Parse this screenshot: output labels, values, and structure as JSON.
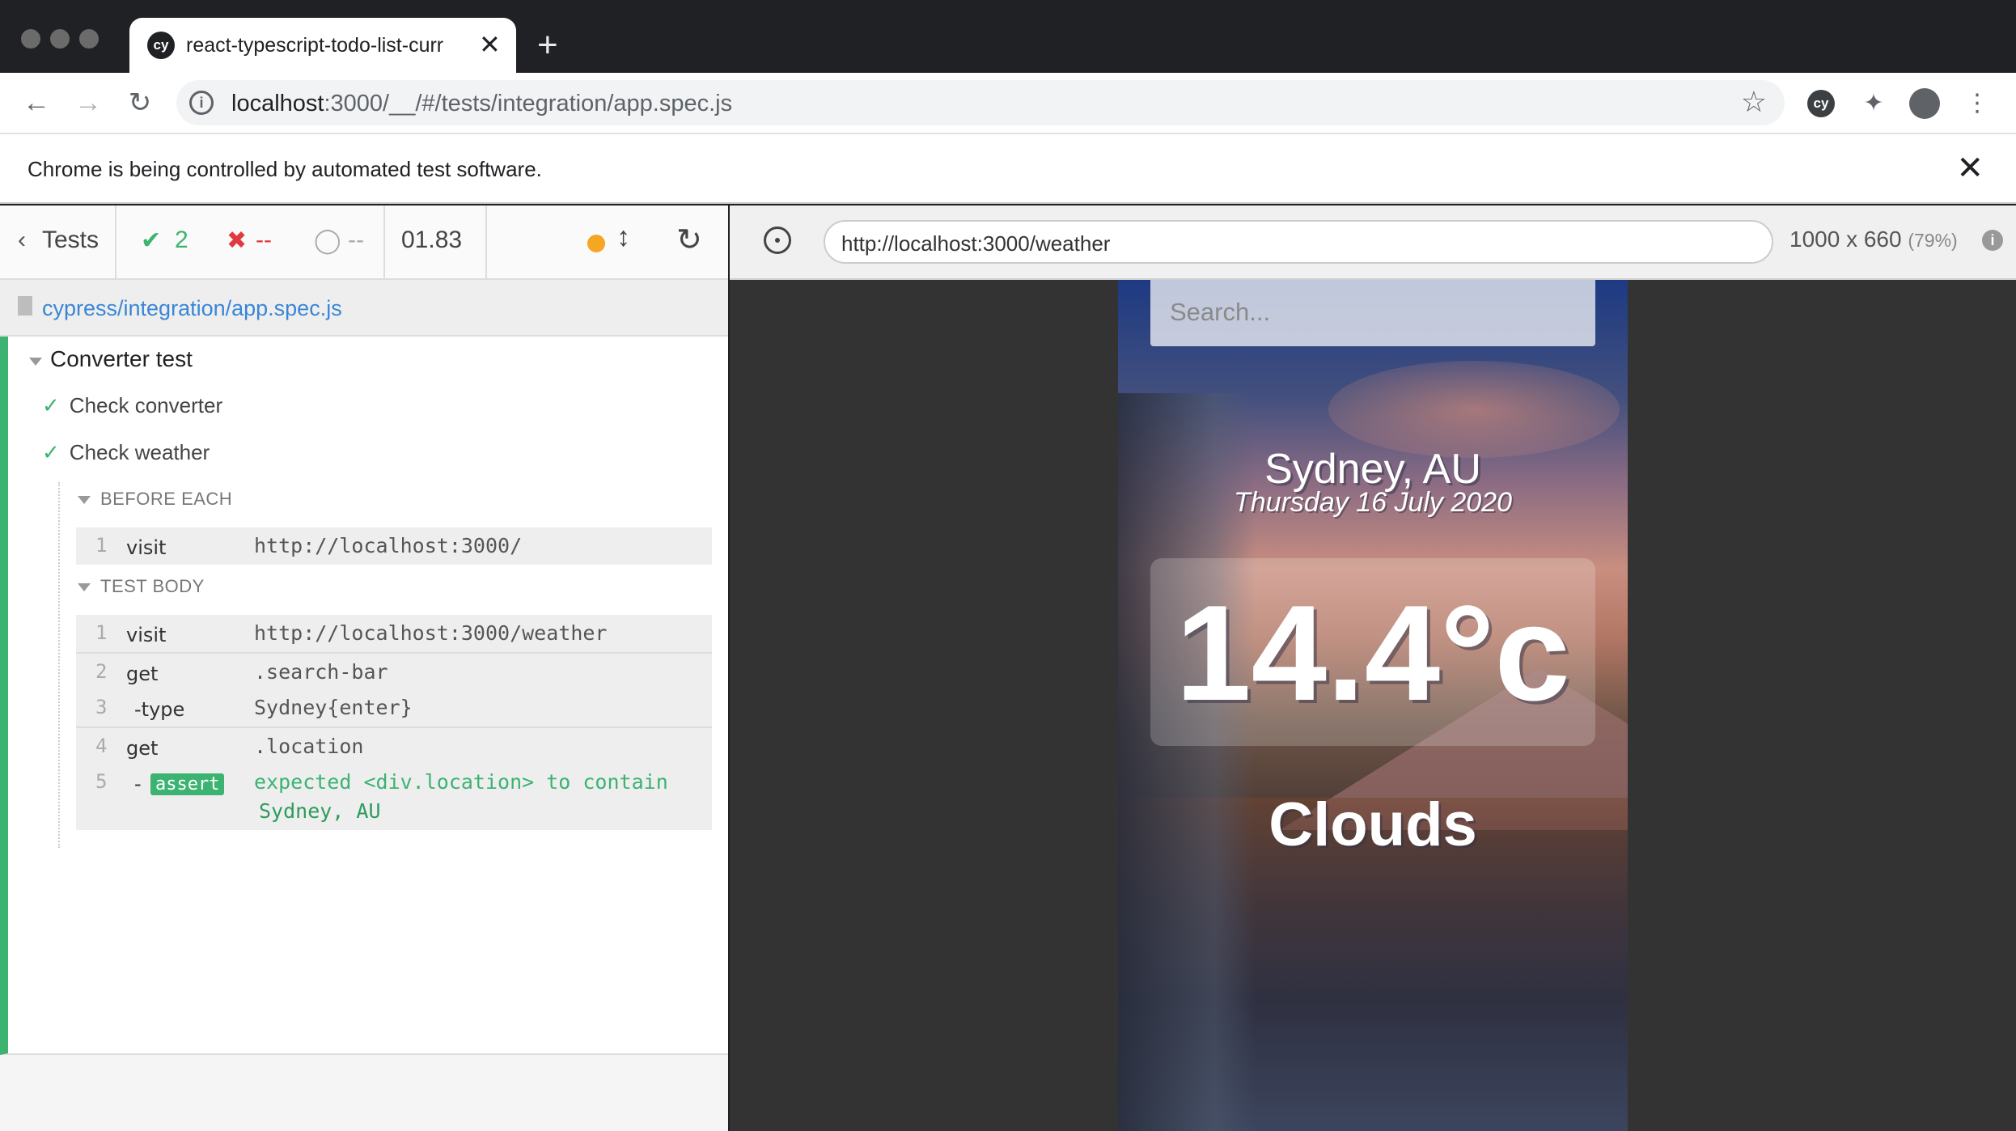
{
  "browser": {
    "tab_title": "react-typescript-todo-list-curr",
    "tab_favicon": "cy",
    "new_tab": "+",
    "tab_close": "✕",
    "url_host": "localhost",
    "url_rest": ":3000/__/#/tests/integration/app.spec.js",
    "extension_label": "cy",
    "infobar_text": "Chrome is being controlled by automated test software.",
    "infobar_close": "✕"
  },
  "icons": {
    "back": "back-arrow-icon",
    "forward": "forward-arrow-icon",
    "reload": "reload-icon",
    "info": "info-icon",
    "star": "star-icon",
    "puzzle": "extensions-icon",
    "profile": "profile-icon",
    "menu": "more-vert-icon"
  },
  "reporter": {
    "tests_label": "Tests",
    "passed": "2",
    "failed": "--",
    "pending": "--",
    "duration": "01.83",
    "spec_path": "cypress/integration/app.spec.js",
    "suite_title": "Converter test",
    "tests": [
      {
        "title": "Check converter"
      },
      {
        "title": "Check weather"
      }
    ],
    "before_each_label": "BEFORE EACH",
    "test_body_label": "TEST BODY",
    "before_each_cmds": [
      {
        "num": "1",
        "name": "visit",
        "message": "http://localhost:3000/"
      }
    ],
    "test_body_cmds": [
      {
        "num": "1",
        "name": "visit",
        "message": "http://localhost:3000/weather"
      },
      {
        "num": "2",
        "name": "get",
        "message": ".search-bar"
      },
      {
        "num": "3",
        "name": "-type",
        "message": "Sydney{enter}"
      },
      {
        "num": "4",
        "name": "get",
        "message": ".location"
      },
      {
        "num": "5",
        "name": "-",
        "badge": "assert",
        "message_line1": "expected <div.location> to contain",
        "message_line2": "Sydney, AU"
      }
    ],
    "colors": {
      "pass": "#3cb371",
      "fail": "#e0393e",
      "link": "#3a86d6",
      "running": "#f5a623"
    }
  },
  "aut": {
    "url": "http://localhost:3000/weather",
    "viewport": "1000 x 660",
    "scale": "(79%)"
  },
  "weather_app": {
    "search_placeholder": "Search...",
    "location": "Sydney, AU",
    "date": "Thursday 16 July 2020",
    "temperature": "14.4°c",
    "condition": "Clouds"
  }
}
